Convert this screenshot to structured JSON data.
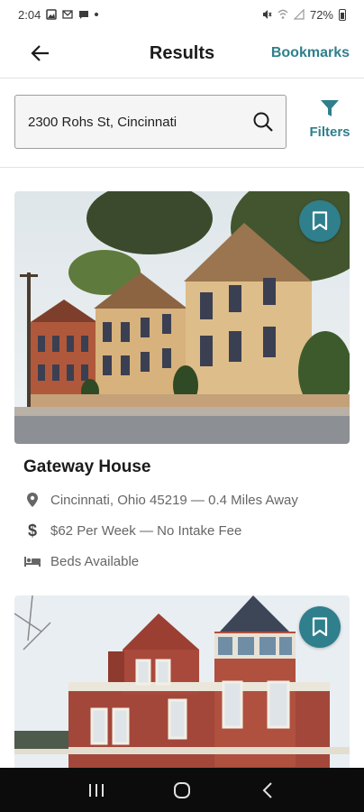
{
  "status_bar": {
    "time": "2:04",
    "battery_text": "72%",
    "icons": [
      "gallery-icon",
      "mail-icon",
      "chat-icon",
      "mute-icon",
      "wifi-icon",
      "signal-icon",
      "battery-icon"
    ]
  },
  "header": {
    "title": "Results",
    "bookmarks_label": "Bookmarks",
    "back_icon": "arrow-left-icon"
  },
  "search": {
    "value": "2300 Rohs St, Cincinnati",
    "icon": "search-icon",
    "filters_label": "Filters",
    "filters_icon": "filter-funnel-icon"
  },
  "results": [
    {
      "name": "Gateway House",
      "location": "Cincinnati, Ohio 45219 — 0.4 Miles Away",
      "price": "$62 Per Week — No Intake Fee",
      "beds": "Beds Available",
      "bookmark_icon": "bookmark-icon"
    },
    {
      "name": "",
      "bookmark_icon": "bookmark-icon"
    }
  ],
  "colors": {
    "accent": "#2f7f8c",
    "nav_bar": "#0c0c0c"
  },
  "nav_bar": {
    "icons": [
      "recent-apps-icon",
      "home-icon",
      "back-chevron-icon"
    ]
  }
}
